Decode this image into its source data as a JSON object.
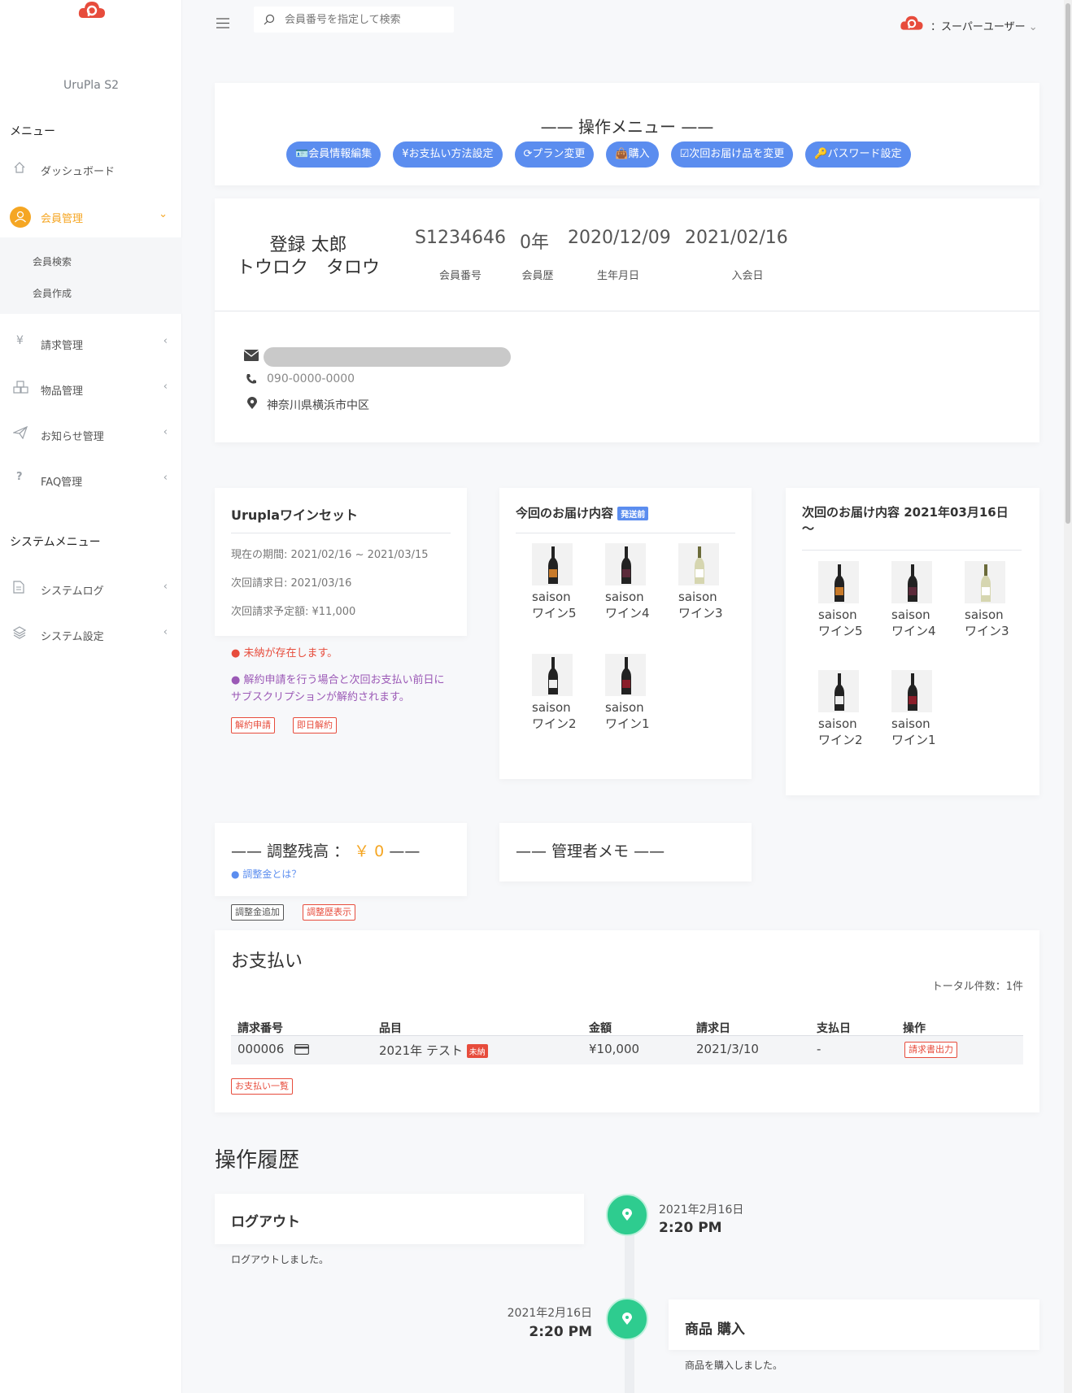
{
  "brand": {
    "app_name": "UruPla S2",
    "logo_icon": "cloud-logo-icon"
  },
  "colors": {
    "primary": "#5b8def",
    "accent": "#f5a623",
    "danger": "#e74c3c",
    "success": "#2ecc8f"
  },
  "search": {
    "placeholder": "会員番号を指定して検索"
  },
  "user": {
    "name": "：スーパーユーザー"
  },
  "sidebar": {
    "menu_title": "メニュー",
    "items": [
      {
        "label": "ダッシュボード",
        "icon": "home-icon"
      },
      {
        "label": "会員管理",
        "icon": "user-icon"
      },
      {
        "label": "請求管理",
        "icon": "yen-icon"
      },
      {
        "label": "物品管理",
        "icon": "boxes-icon"
      },
      {
        "label": "お知らせ管理",
        "icon": "paper-plane-icon"
      },
      {
        "label": "FAQ管理",
        "icon": "question-icon"
      }
    ],
    "sub_items": [
      {
        "label": "会員検索"
      },
      {
        "label": "会員作成"
      }
    ],
    "system_title": "システムメニュー",
    "system_items": [
      {
        "label": "システムログ",
        "icon": "document-icon"
      },
      {
        "label": "システム設定",
        "icon": "layers-icon"
      }
    ]
  },
  "ops": {
    "title": "—— 操作メニュー ——",
    "buttons": [
      {
        "label": "会員情報編集",
        "icon": "id-card-icon"
      },
      {
        "label": "お支払い方法設定",
        "icon": "yen-icon"
      },
      {
        "label": "プラン変更",
        "icon": "refresh-icon"
      },
      {
        "label": "購入",
        "icon": "bag-icon"
      },
      {
        "label": "次回お届け品を変更",
        "icon": "check-square-icon"
      },
      {
        "label": "パスワード設定",
        "icon": "key-icon"
      }
    ]
  },
  "member": {
    "name": "登録 太郎",
    "kana": "トウロク　タロウ",
    "number": "S1234646",
    "number_label": "会員番号",
    "tenure": "0年",
    "tenure_label": "会員歴",
    "birthday": "2020/12/09",
    "birthday_label": "生年月日",
    "joined": "2021/02/16",
    "joined_label": "入会日",
    "phone": "090-0000-0000",
    "address": "神奈川県横浜市中区"
  },
  "plan": {
    "title": "Uruplaワインセット",
    "period": "現在の期間: 2021/02/16 ~ 2021/03/15",
    "next_bill": "次回請求日: 2021/03/16",
    "next_amount": "次回請求予定額: ¥11,000",
    "alert_unpaid": "未納が存在します。",
    "alert_cancel": "解約申請を行う場合と次回お支払い前日にサブスクリプションが解約されます。",
    "btn_cancel": "解約申請",
    "btn_cancel_now": "即日解約"
  },
  "current_delivery": {
    "title": "今回のお届け内容",
    "badge": "発送前",
    "items": [
      "saisonワイン5",
      "saisonワイン4",
      "saisonワイン3",
      "saisonワイン2",
      "saisonワイン1"
    ]
  },
  "next_delivery": {
    "title": "次回のお届け内容 2021年03月16日 ～",
    "items": [
      "saisonワイン5",
      "saisonワイン4",
      "saisonワイン3",
      "saisonワイン2",
      "saisonワイン1"
    ]
  },
  "balance": {
    "title_pre": "—— 調整残高 ：",
    "value": "￥ 0",
    "title_post": " ——",
    "help": "調整金とは？",
    "btn_add": "調整金追加",
    "btn_history": "調整歴表示"
  },
  "memo": {
    "title": "—— 管理者メモ ——"
  },
  "payments": {
    "title": "お支払い",
    "total": "トータル件数：1件",
    "columns": [
      "請求番号",
      "品目",
      "金額",
      "請求日",
      "支払日",
      "操作"
    ],
    "row": {
      "id": "000006",
      "item": "2021年 テスト",
      "badge": "未納",
      "amount": "¥10,000",
      "billed": "2021/3/10",
      "paid": "-",
      "action": "請求書出力"
    },
    "list_button": "お支払い一覧"
  },
  "history": {
    "title": "操作履歴",
    "events": [
      {
        "title": "ログアウト",
        "body": "ログアウトしました。",
        "date": "2021年2月16日",
        "time": "2:20 PM"
      },
      {
        "title": "商品 購入",
        "body": "商品を購入しました。",
        "date": "2021年2月16日",
        "time": "2:20 PM"
      }
    ]
  }
}
